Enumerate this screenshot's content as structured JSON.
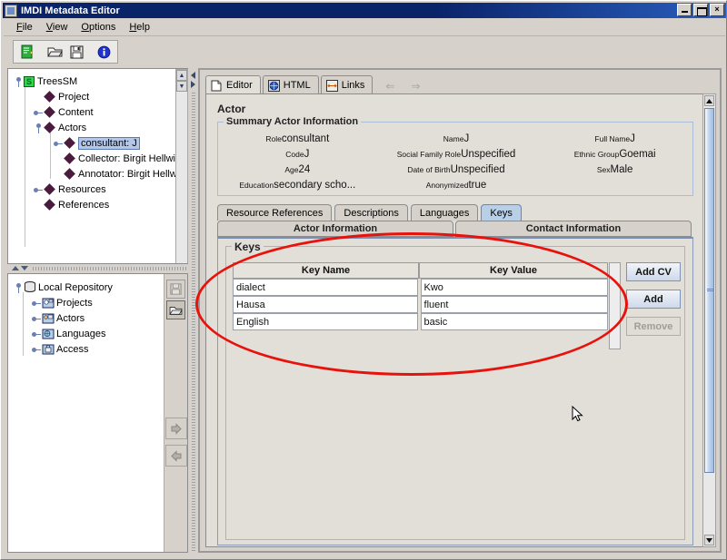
{
  "window": {
    "title": "IMDI Metadata Editor",
    "icon": "app-icon",
    "controls": {
      "minimize": "_",
      "maximize": "□",
      "close": "×"
    }
  },
  "menubar": {
    "items": [
      {
        "label": "File",
        "mnemonic": "F"
      },
      {
        "label": "View",
        "mnemonic": "V"
      },
      {
        "label": "Options",
        "mnemonic": "O"
      },
      {
        "label": "Help",
        "mnemonic": "H"
      }
    ]
  },
  "toolbar": {
    "buttons": [
      {
        "name": "new-document-icon",
        "title": "New"
      },
      {
        "name": "open-folder-icon",
        "title": "Open"
      },
      {
        "name": "save-floppy-icon",
        "title": "Save"
      },
      {
        "name": "info-icon",
        "title": "Info"
      }
    ]
  },
  "tree": {
    "root": "TreesSM",
    "nodes": [
      {
        "label": "Project",
        "depth": 1,
        "expandable": false
      },
      {
        "label": "Content",
        "depth": 1,
        "expandable": true
      },
      {
        "label": "Actors",
        "depth": 1,
        "expandable": true,
        "expanded": true
      },
      {
        "label": "consultant: J",
        "depth": 2,
        "expandable": true,
        "selected": true
      },
      {
        "label": "Collector: Birgit Hellwig",
        "depth": 2,
        "expandable": false
      },
      {
        "label": "Annotator: Birgit Hellwig",
        "depth": 2,
        "expandable": false
      },
      {
        "label": "Resources",
        "depth": 1,
        "expandable": true
      },
      {
        "label": "References",
        "depth": 1,
        "expandable": false
      }
    ]
  },
  "repository": {
    "root": "Local Repository",
    "items": [
      {
        "label": "Projects",
        "icon": "project-folder-icon"
      },
      {
        "label": "Actors",
        "icon": "actors-folder-icon"
      },
      {
        "label": "Languages",
        "icon": "languages-folder-icon"
      },
      {
        "label": "Access",
        "icon": "access-folder-icon"
      }
    ],
    "side_buttons": [
      {
        "name": "repository-save-button",
        "icon": "save-floppy-icon",
        "enabled": false
      },
      {
        "name": "repository-open-button",
        "icon": "open-folder-icon",
        "enabled": true
      }
    ],
    "transfer_buttons": [
      {
        "name": "move-right-button",
        "icon": "arrow-right-icon"
      },
      {
        "name": "move-left-button",
        "icon": "arrow-left-icon"
      }
    ]
  },
  "editor": {
    "tabs": [
      {
        "label": "Editor",
        "icon": "document-icon",
        "active": true
      },
      {
        "label": "HTML",
        "icon": "globe-icon",
        "active": false
      },
      {
        "label": "Links",
        "icon": "link-icon",
        "active": false
      }
    ],
    "nav": {
      "back": "⇐",
      "forward": "⇒"
    },
    "page_title": "Actor"
  },
  "summary": {
    "legend": "Summary Actor Information",
    "fields": [
      {
        "key": "Role",
        "value": "consultant"
      },
      {
        "key": "Name",
        "value": "J"
      },
      {
        "key": "Full Name",
        "value": "J"
      },
      {
        "key": "Code",
        "value": "J"
      },
      {
        "key": "Social Family Role",
        "value": "Unspecified"
      },
      {
        "key": "Ethnic Group",
        "value": "Goemai"
      },
      {
        "key": "Age",
        "value": "24"
      },
      {
        "key": "Date of Birth",
        "value": "Unspecified"
      },
      {
        "key": "Sex",
        "value": "Male"
      },
      {
        "key": "Education",
        "value": "secondary scho..."
      },
      {
        "key": "Anonymized",
        "value": "true"
      },
      {
        "key": "",
        "value": ""
      }
    ]
  },
  "form_tabs": {
    "row1": [
      {
        "label": "Resource References",
        "active": false
      },
      {
        "label": "Descriptions",
        "active": false
      },
      {
        "label": "Languages",
        "active": false
      },
      {
        "label": "Keys",
        "active": true
      }
    ],
    "row2": [
      {
        "label": "Actor Information"
      },
      {
        "label": "Contact Information"
      }
    ]
  },
  "keys": {
    "legend": "Keys",
    "columns": [
      "Key Name",
      "Key Value"
    ],
    "rows": [
      {
        "name": "dialect",
        "value": "Kwo"
      },
      {
        "name": "Hausa",
        "value": "fluent"
      },
      {
        "name": "English",
        "value": "basic"
      }
    ],
    "buttons": [
      {
        "label": "Add CV",
        "enabled": true
      },
      {
        "label": "Add",
        "enabled": true
      },
      {
        "label": "Remove",
        "enabled": false
      }
    ]
  },
  "annotation": {
    "shape": "ellipse",
    "color": "#e8120c"
  },
  "colors": {
    "title_bar": "#0a246a",
    "window_bg": "#d6d2cb",
    "panel_bg": "#e2dfd9",
    "selected_tab": "#b9cfe8",
    "tree_selection": "#b5c7e7",
    "diamond_node": "#4a1b3d",
    "annotation_red": "#e8120c"
  }
}
